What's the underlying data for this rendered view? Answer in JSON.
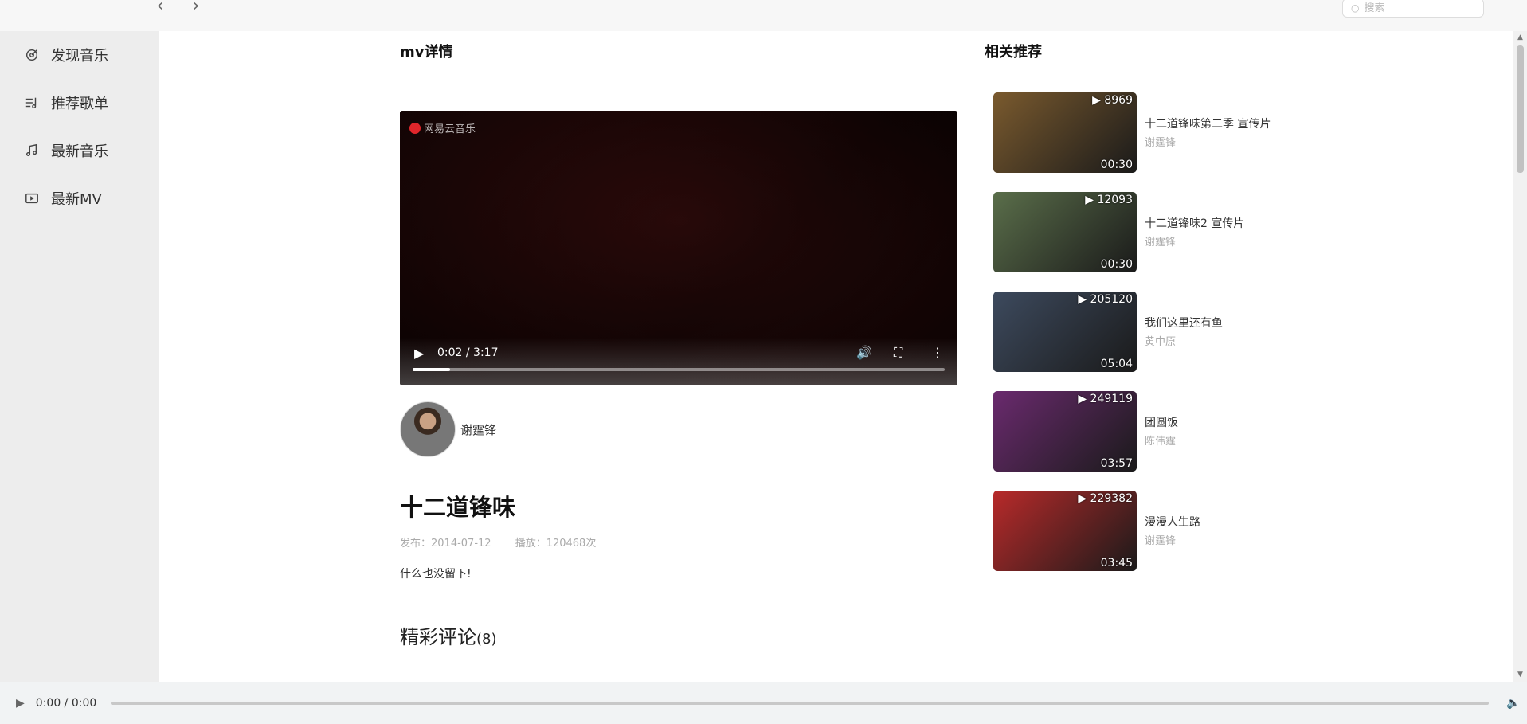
{
  "search": {
    "placeholder": "搜索"
  },
  "sidebar": {
    "items": [
      {
        "label": "发现音乐",
        "icon": "target-icon"
      },
      {
        "label": "推荐歌单",
        "icon": "playlist-icon"
      },
      {
        "label": "最新音乐",
        "icon": "music-note-icon"
      },
      {
        "label": "最新MV",
        "icon": "video-icon"
      }
    ]
  },
  "detail": {
    "section_title": "mv详情",
    "watermark": "网易云音乐",
    "video": {
      "time": "0:02 / 3:17",
      "progress": 0.07
    },
    "artist": "谢霆锋",
    "title": "十二道锋味",
    "publish": "发布：2014-07-12",
    "plays": "播放：120468次",
    "description": "什么也没留下!",
    "comments_label": "精彩评论",
    "comments_count": "(8)"
  },
  "recommend": {
    "section_title": "相关推荐",
    "items": [
      {
        "title": "十二道锋味第二季 宣传片",
        "artist": "谢霆锋",
        "count": "8969",
        "duration": "00:30",
        "color": "#7a5a2e"
      },
      {
        "title": "十二道锋味2 宣传片",
        "artist": "谢霆锋",
        "count": "12093",
        "duration": "00:30",
        "color": "#5a6e4a"
      },
      {
        "title": "我们这里还有鱼",
        "artist": "黄中原",
        "count": "205120",
        "duration": "05:04",
        "color": "#3d4a5e"
      },
      {
        "title": "团圆饭",
        "artist": "陈伟霆",
        "count": "249119",
        "duration": "03:57",
        "color": "#6a2a6e"
      },
      {
        "title": "漫漫人生路",
        "artist": "谢霆锋",
        "count": "229382",
        "duration": "03:45",
        "color": "#b82a2a"
      }
    ]
  },
  "player": {
    "time": "0:00 / 0:00"
  }
}
